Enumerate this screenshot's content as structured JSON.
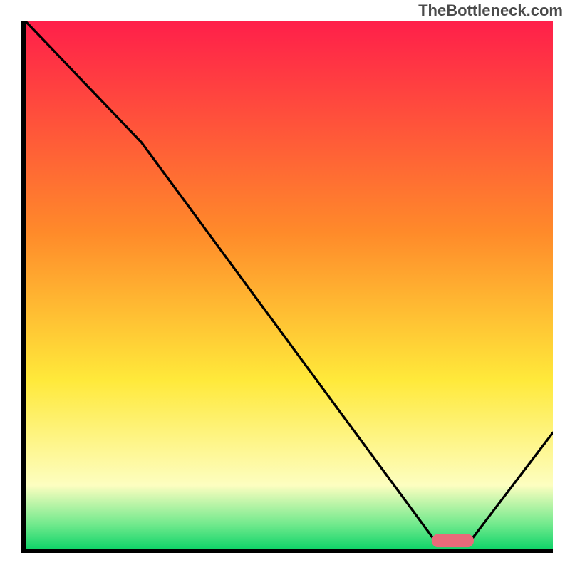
{
  "watermark": "TheBottleneck.com",
  "chart_data": {
    "type": "line",
    "title": "",
    "xlabel": "",
    "ylabel": "",
    "xlim": [
      0,
      100
    ],
    "ylim": [
      0,
      100
    ],
    "series": [
      {
        "name": "curve",
        "x": [
          0,
          22,
          78,
          84,
          100
        ],
        "y": [
          100,
          77,
          1,
          1,
          22
        ]
      }
    ],
    "background_gradient": {
      "stops": [
        {
          "offset": 0.0,
          "color": "#ff1f4a"
        },
        {
          "offset": 0.4,
          "color": "#ff8a2a"
        },
        {
          "offset": 0.68,
          "color": "#ffe93a"
        },
        {
          "offset": 0.88,
          "color": "#fdfec0"
        },
        {
          "offset": 0.955,
          "color": "#6fe98c"
        },
        {
          "offset": 1.0,
          "color": "#12d46a"
        }
      ]
    },
    "marker": {
      "x": 81,
      "y": 1.5,
      "width": 8,
      "height": 2.5,
      "rx": 1.2,
      "color": "#e96a7a"
    }
  }
}
